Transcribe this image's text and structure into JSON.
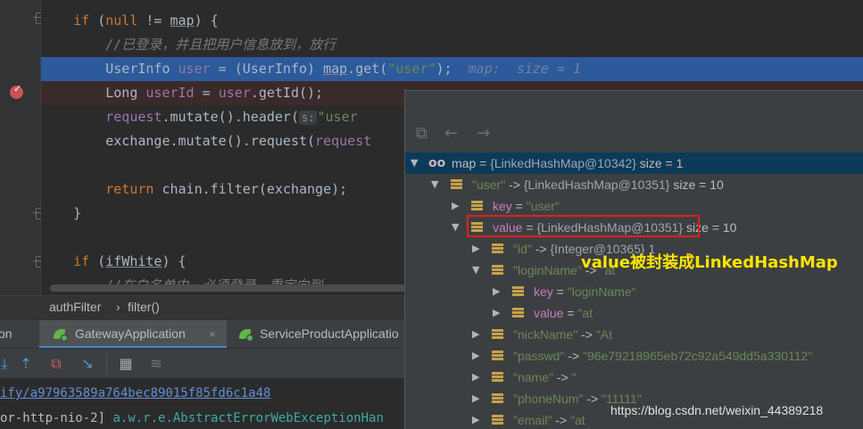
{
  "editor": {
    "lines": [
      {
        "segments": [
          {
            "t": "    if (",
            "c": "kw0"
          },
          {
            "t": "null",
            "c": "kw"
          },
          {
            "t": " != ",
            "c": ""
          },
          {
            "t": "map",
            "c": "ul"
          },
          {
            "t": ") {",
            "c": ""
          }
        ]
      },
      {
        "segments": [
          {
            "t": "        //已登录，并且把用户信息放到，放行",
            "c": "cmtc"
          }
        ]
      },
      {
        "segments": [
          {
            "t": "        UserInfo ",
            "c": ""
          },
          {
            "t": "user",
            "c": "fld"
          },
          {
            "t": " = (UserInfo) ",
            "c": ""
          },
          {
            "t": "map",
            "c": "ul"
          },
          {
            "t": ".get(",
            "c": ""
          },
          {
            "t": "\"user\"",
            "c": "str"
          },
          {
            "t": ");  ",
            "c": ""
          },
          {
            "t": "map:  size = 1",
            "c": "hint"
          }
        ]
      },
      {
        "segments": [
          {
            "t": "        Long ",
            "c": ""
          },
          {
            "t": "userId",
            "c": "fld"
          },
          {
            "t": " = ",
            "c": ""
          },
          {
            "t": "user",
            "c": "fld"
          },
          {
            "t": ".getId();",
            "c": ""
          }
        ]
      },
      {
        "segments": [
          {
            "t": "        request",
            "c": "fld"
          },
          {
            "t": ".mutate().header(",
            "c": ""
          },
          {
            "t": "s:",
            "c": "pname"
          },
          {
            "t": "\"user",
            "c": "str"
          }
        ]
      },
      {
        "segments": [
          {
            "t": "        exchange.mutate().request(",
            "c": ""
          },
          {
            "t": "request",
            "c": "fld"
          }
        ]
      },
      {
        "segments": []
      },
      {
        "segments": [
          {
            "t": "        return",
            "c": "kw"
          },
          {
            "t": " chain.filter(exchange);",
            "c": ""
          }
        ]
      },
      {
        "segments": [
          {
            "t": "    }",
            "c": ""
          }
        ]
      },
      {
        "segments": []
      },
      {
        "segments": [
          {
            "t": "    if",
            "c": "kw"
          },
          {
            "t": " (",
            "c": ""
          },
          {
            "t": "ifWhite",
            "c": "ul"
          },
          {
            "t": ") {",
            "c": ""
          }
        ]
      },
      {
        "segments": [
          {
            "t": "        //在白名单中，必须登录，重定向到",
            "c": "cmtc"
          }
        ]
      }
    ],
    "line_if_null": "if (null != map) {"
  },
  "breadcrumb": {
    "method_class": "authFilter",
    "separator": "›",
    "method": "filter()"
  },
  "tabs": [
    {
      "label": "on",
      "partial": true
    },
    {
      "label": "GatewayApplication",
      "active": true,
      "close": "×"
    },
    {
      "label": "ServiceProductApplicatio",
      "active": false
    }
  ],
  "console": {
    "line1": "ify/a97963589a764bec89015f85fd6c1a48",
    "line2_prefix": "or-http-nio-2] ",
    "line2_logger": "a.w.r.e.AbstractErrorWebExceptionHan"
  },
  "debugger": {
    "rows": [
      {
        "depth": 0,
        "arrow": "down",
        "icon": "oo",
        "name": "map",
        "eq": " = ",
        "ref": "{LinkedHashMap@10342}",
        "extra": " size = 1",
        "selected": true
      },
      {
        "depth": 1,
        "arrow": "down",
        "icon": "field",
        "name_str": "\"user\"",
        "mid": " -> ",
        "ref": "{LinkedHashMap@10351}",
        "extra": " size = 10"
      },
      {
        "depth": 2,
        "arrow": "right",
        "icon": "field",
        "name": "key",
        "eq": " = ",
        "val_str": "\"user\""
      },
      {
        "depth": 2,
        "arrow": "down",
        "icon": "field",
        "name": "value",
        "eq": " = ",
        "ref": "{LinkedHashMap@10351}",
        "extra": " size = 10"
      },
      {
        "depth": 3,
        "arrow": "right",
        "icon": "field",
        "name_str": "\"id\"",
        "mid": " -> ",
        "ref": "{Integer@10365} 1"
      },
      {
        "depth": 3,
        "arrow": "down",
        "icon": "field",
        "name_str": "\"loginName\"",
        "mid": " -> ",
        "val_str": "\"at"
      },
      {
        "depth": 4,
        "arrow": "right",
        "icon": "field",
        "name": "key",
        "eq": " = ",
        "val_str": "\"loginName\""
      },
      {
        "depth": 4,
        "arrow": "right",
        "icon": "field",
        "name": "value",
        "eq": " = ",
        "val_str": "\"at"
      },
      {
        "depth": 3,
        "arrow": "right",
        "icon": "field",
        "name_str": "\"nickName\"",
        "mid": " -> ",
        "val_str": "\"At"
      },
      {
        "depth": 3,
        "arrow": "right",
        "icon": "field",
        "name_str": "\"passwd\"",
        "mid": " -> ",
        "val_str": "\"96e79218965eb72c92a549dd5a330112\""
      },
      {
        "depth": 3,
        "arrow": "right",
        "icon": "field",
        "name_str": "\"name\"",
        "mid": " -> ",
        "val_str": "\""
      },
      {
        "depth": 3,
        "arrow": "right",
        "icon": "field",
        "name_str": "\"phoneNum\"",
        "mid": " -> ",
        "val_str": "\"11111\""
      },
      {
        "depth": 3,
        "arrow": "right",
        "icon": "field",
        "name_str": "\"email\"",
        "mid": " -> ",
        "val_str": "\"at"
      }
    ]
  },
  "annotation": "value被封装成LinkedHashMap",
  "watermark": "https://blog.csdn.net/weixin_44389218",
  "colors": {
    "accent": "#2d5a9a",
    "annotation": "#ffe400",
    "highlight_box": "#e02020"
  }
}
